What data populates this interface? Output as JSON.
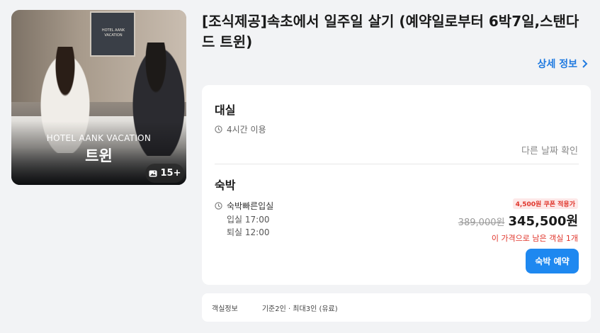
{
  "gallery": {
    "hotel_name": "HOTEL AANK VACATION",
    "room_type": "트윈",
    "photo_count": "15+",
    "frame_text": "HOTEL AANK VACATION"
  },
  "product": {
    "title": "[조식제공]속초에서 일주일 살기 (예약일로부터 6박7일,스탠다드 트윈)",
    "detail_link": "상세 정보"
  },
  "dayuse": {
    "title": "대실",
    "duration": "4시간 이용",
    "other_date": "다른 날짜 확인"
  },
  "stay": {
    "title": "숙박",
    "option": "숙박빠른입실",
    "checkin": "입실 17:00",
    "checkout": "퇴실 12:00",
    "coupon": "4,500원 쿠폰 적용가",
    "price_original": "389,000원",
    "price_final": "345,500원",
    "remaining": "이 가격으로 남은 객실 1개",
    "book_label": "숙박 예약"
  },
  "room_info": {
    "label": "객실정보",
    "value": "기준2인 · 최대3인 (유료)"
  },
  "colors": {
    "accent": "#1e88f0",
    "link": "#1f7ae0",
    "alert": "#e0352b",
    "background": "#f2f3f5"
  }
}
